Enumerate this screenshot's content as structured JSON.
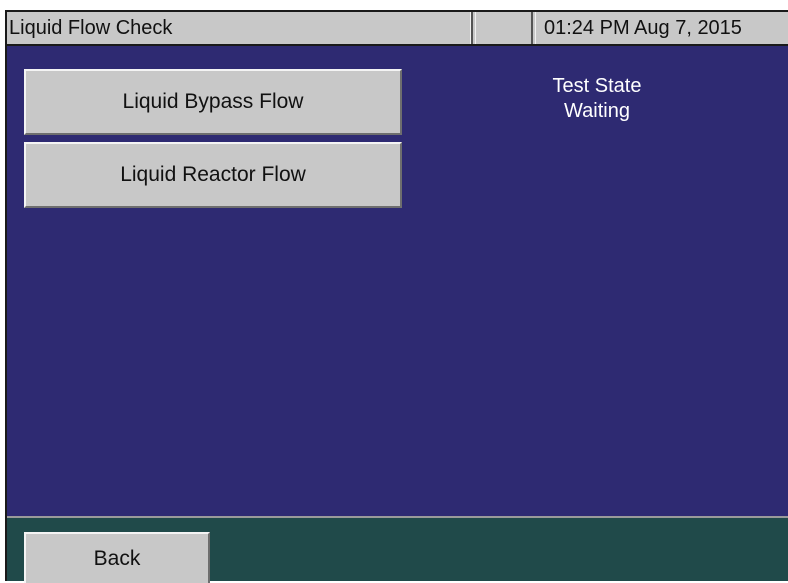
{
  "header": {
    "title": "Liquid Flow Check",
    "middle": "",
    "datetime": "01:24 PM Aug 7, 2015"
  },
  "main": {
    "buttons": [
      {
        "label": "Liquid Bypass Flow"
      },
      {
        "label": "Liquid Reactor Flow"
      }
    ],
    "status": {
      "label": "Test State",
      "value": "Waiting"
    }
  },
  "footer": {
    "back_label": "Back"
  },
  "colors": {
    "background": "#2e2a72",
    "footer": "#204a4a",
    "button": "#c8c8c8",
    "title_bar": "#c8c8c8",
    "status_text": "#ffffff"
  }
}
